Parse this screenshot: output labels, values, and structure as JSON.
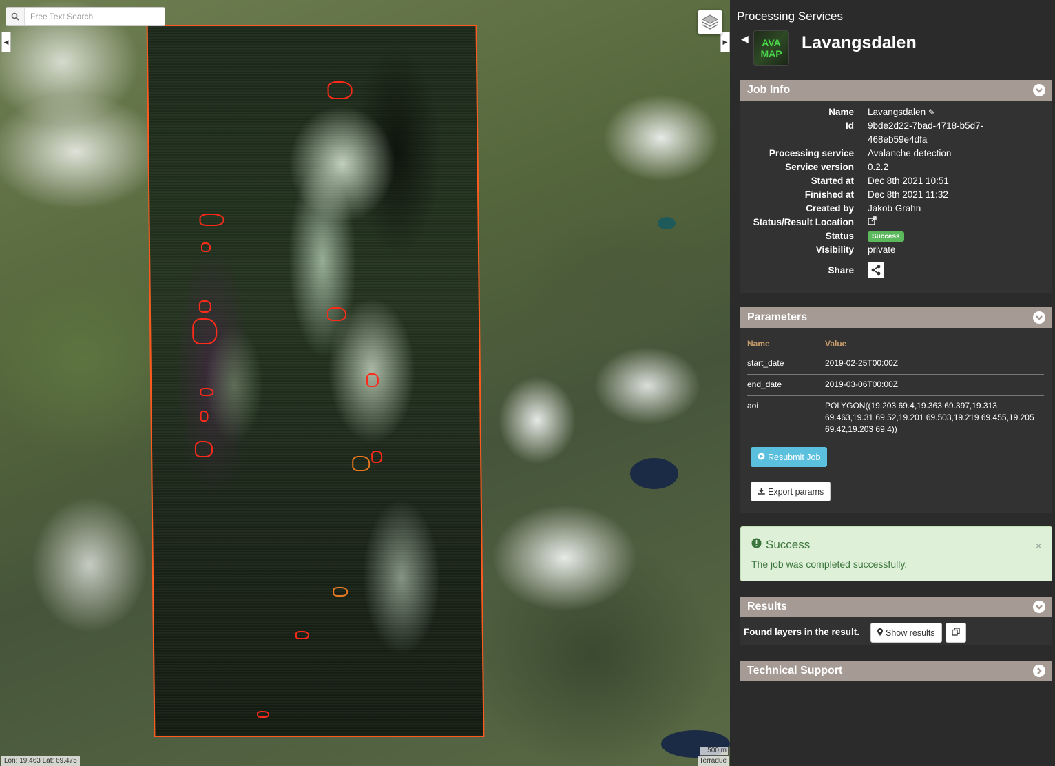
{
  "map": {
    "search_placeholder": "Free Text Search",
    "coords": "Lon: 19.463 Lat: 69.475",
    "scale": "500 m",
    "attribution": "Terradue",
    "layers_icon": "layers-icon"
  },
  "panel": {
    "title": "Processing Services",
    "job_title": "Lavangsdalen",
    "logo_lines": [
      "AVA",
      "MAP"
    ]
  },
  "job_info": {
    "header": "Job Info",
    "rows": {
      "name_label": "Name",
      "name_value": "Lavangsdalen",
      "id_label": "Id",
      "id_value_1": "9bde2d22-7bad-4718-b5d7-",
      "id_value_2": "468eb59e4dfa",
      "service_label": "Processing service",
      "service_value": "Avalanche detection",
      "version_label": "Service version",
      "version_value": "0.2.2",
      "started_label": "Started at",
      "started_value": "Dec 8th 2021 10:51",
      "finished_label": "Finished at",
      "finished_value": "Dec 8th 2021 11:32",
      "created_label": "Created by",
      "created_value": "Jakob Grahn",
      "location_label": "Status/Result Location",
      "status_label": "Status",
      "status_value": "Success",
      "visibility_label": "Visibility",
      "visibility_value": "private",
      "share_label": "Share"
    }
  },
  "parameters": {
    "header": "Parameters",
    "col_name": "Name",
    "col_value": "Value",
    "rows": [
      {
        "name": "start_date",
        "value": "2019-02-25T00:00Z"
      },
      {
        "name": "end_date",
        "value": "2019-03-06T00:00Z"
      },
      {
        "name": "aoi",
        "value": "POLYGON((19.203 69.4,19.363 69.397,19.313 69.463,19.31 69.52,19.201 69.503,19.219 69.455,19.205 69.42,19.203 69.4))"
      }
    ],
    "resubmit_label": "Resubmit Job",
    "export_label": "Export params"
  },
  "alert": {
    "title": "Success",
    "body": "The job was completed successfully.",
    "close": "×"
  },
  "results": {
    "header": "Results",
    "found_label": "Found layers in the result.",
    "show_label": "Show results"
  },
  "support": {
    "header": "Technical Support"
  },
  "colors": {
    "section_header": "#a59a94",
    "success": "#5cb85c",
    "info_button": "#5bc0de",
    "overlay_border": "#ff5a1e",
    "avalanche": "#ff2a1a"
  }
}
